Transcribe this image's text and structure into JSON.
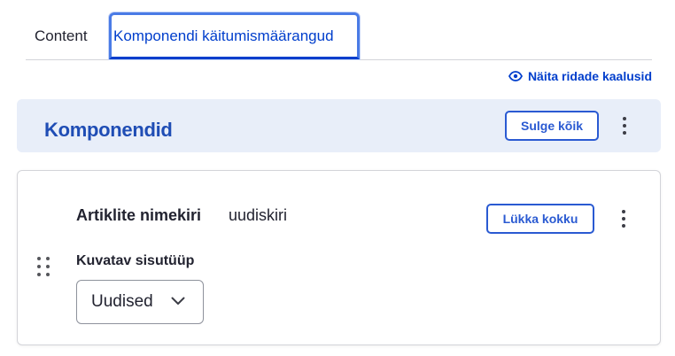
{
  "tabs": [
    {
      "label": "Content",
      "active": false
    },
    {
      "label": "Komponendi käitumismäärangud",
      "active": true
    }
  ],
  "show_row_weights": {
    "label": "Näita ridade kaalusid",
    "icon": "eye-icon"
  },
  "components_header": {
    "title": "Komponendid",
    "collapse_all_label": "Sulge kõik",
    "menu_icon": "kebab-icon"
  },
  "component_card": {
    "title": "Artiklite nimekiri",
    "subtitle": "uudiskiri",
    "collapse_label": "Lükka kokku",
    "drag_icon": "drag-handle-icon",
    "field": {
      "label": "Kuvatav sisutüüp",
      "selected_value": "Uudised"
    }
  },
  "colors": {
    "accent": "#003ecc",
    "header_bg": "#e8eef9",
    "title_blue": "#1f4db5"
  }
}
